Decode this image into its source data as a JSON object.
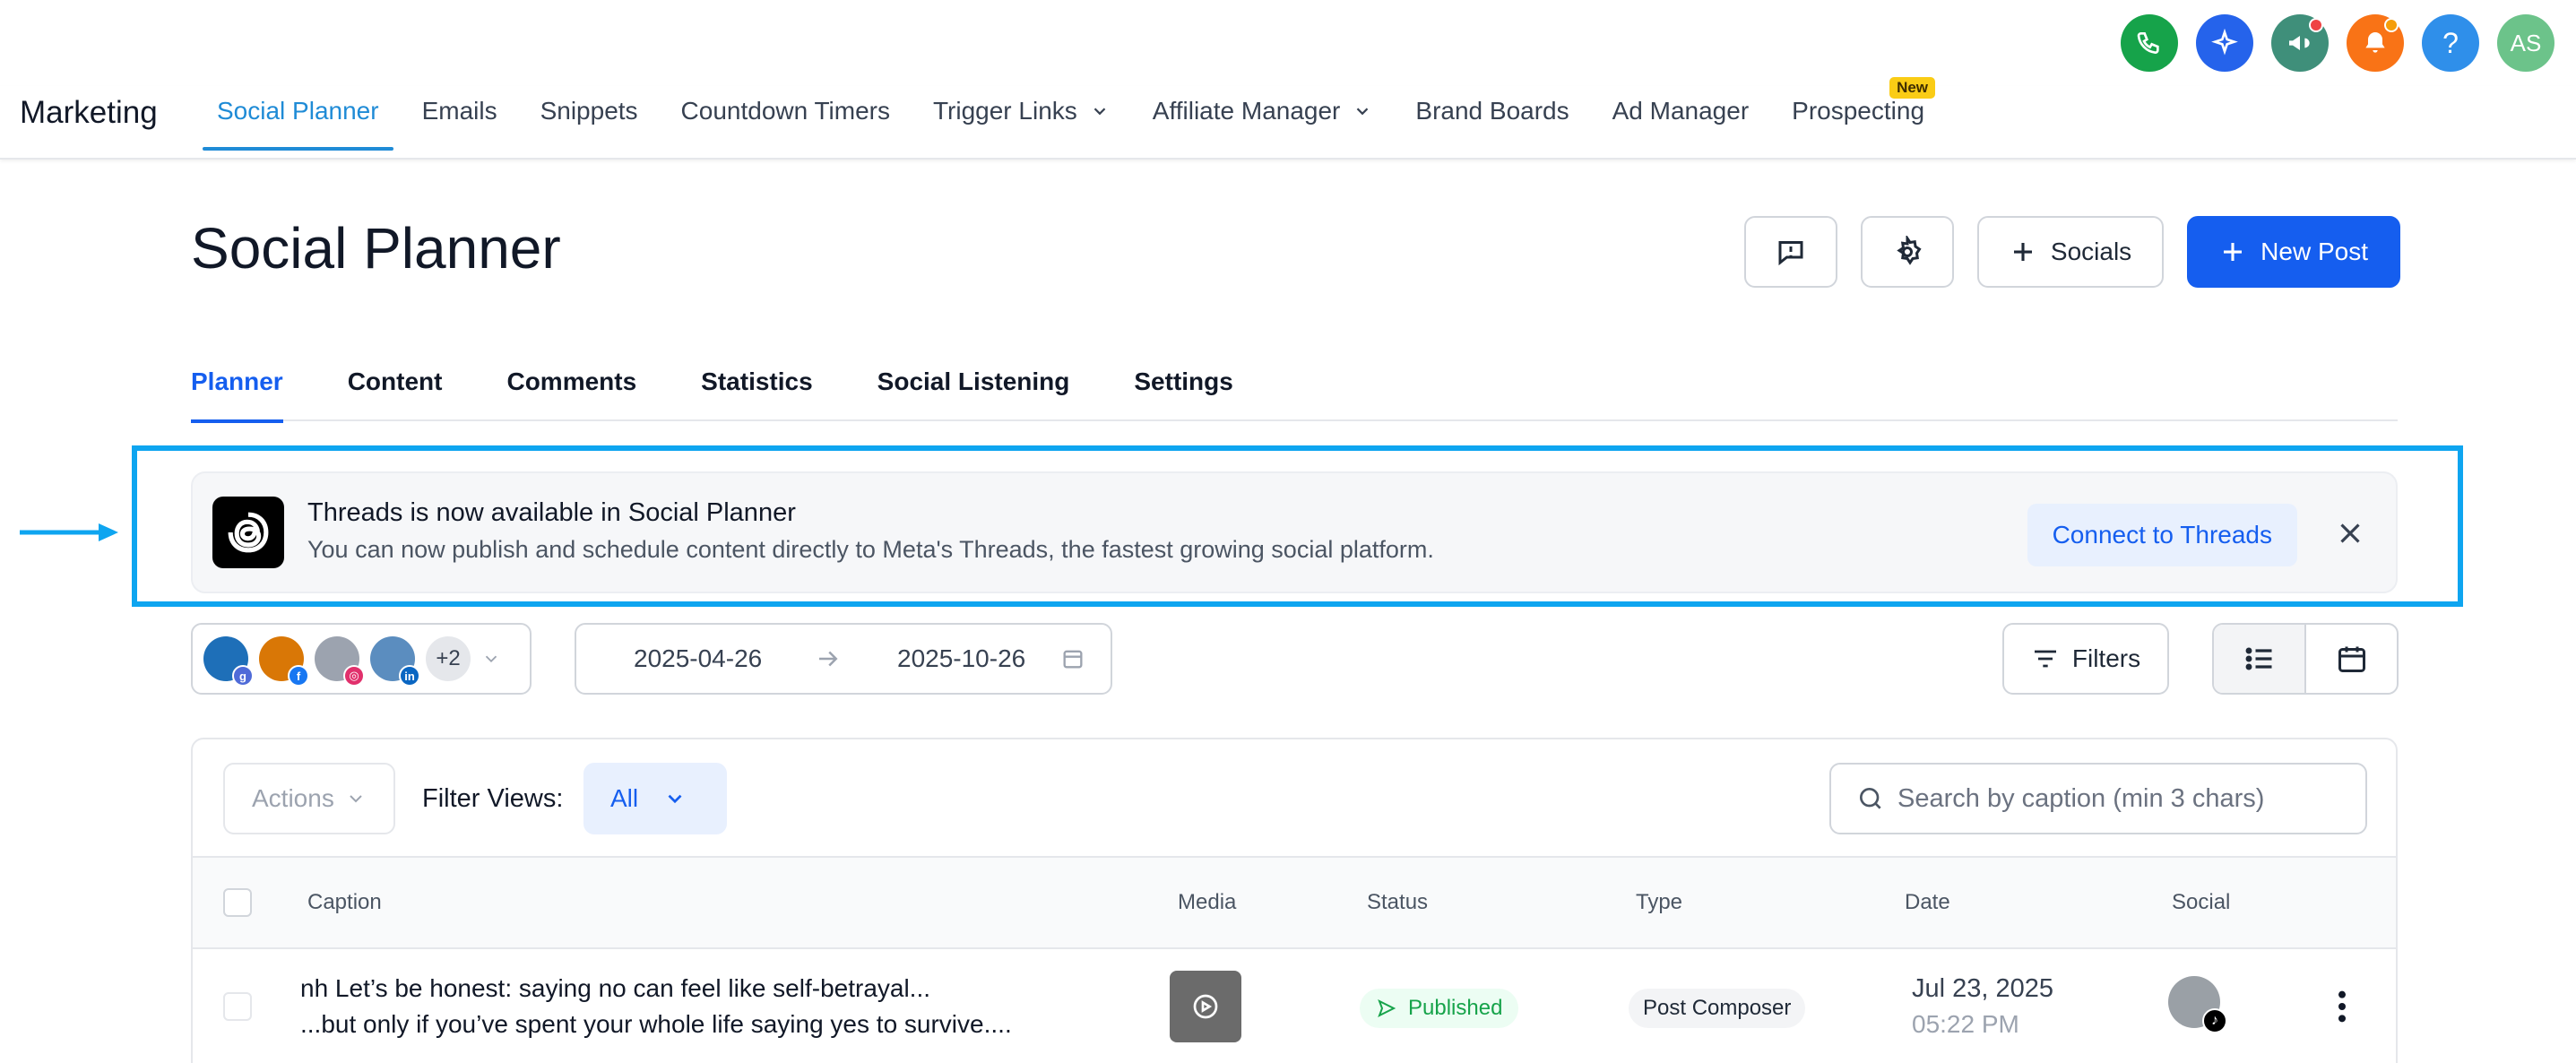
{
  "top_icons": {
    "avatar_initials": "AS",
    "help_symbol": "?",
    "colors": {
      "phone": "#16a34a",
      "ai": "#2563eb",
      "megaphone": "#3f8f7a",
      "bell": "#f97316",
      "help": "#2f8fea",
      "avatar": "#6cc38a",
      "notif_red": "#ef4444",
      "notif_orange": "#f59e0b"
    }
  },
  "header": {
    "brand": "Marketing",
    "nav": [
      {
        "label": "Social Planner",
        "active": true
      },
      {
        "label": "Emails"
      },
      {
        "label": "Snippets"
      },
      {
        "label": "Countdown Timers"
      },
      {
        "label": "Trigger Links",
        "dropdown": true
      },
      {
        "label": "Affiliate Manager",
        "dropdown": true
      },
      {
        "label": "Brand Boards"
      },
      {
        "label": "Ad Manager"
      },
      {
        "label": "Prospecting",
        "badge": "New"
      }
    ]
  },
  "page": {
    "title": "Social Planner",
    "socials_label": "Socials",
    "new_post_label": "New Post",
    "accent": "#155eef"
  },
  "subtabs": [
    "Planner",
    "Content",
    "Comments",
    "Statistics",
    "Social Listening",
    "Settings"
  ],
  "banner": {
    "title": "Threads is now available in Social Planner",
    "text": "You can now publish and schedule content directly to Meta's Threads, the fastest growing social platform.",
    "cta": "Connect to Threads",
    "highlight_color": "#0ea5f0"
  },
  "filters": {
    "more_accounts": "+2",
    "date_start": "2025-04-26",
    "date_end": "2025-10-26",
    "filters_label": "Filters"
  },
  "table": {
    "actions_label": "Actions",
    "filter_views_label": "Filter Views:",
    "filter_views_value": "All",
    "search_placeholder": "Search by caption (min 3 chars)",
    "headers": {
      "caption": "Caption",
      "media": "Media",
      "status": "Status",
      "type": "Type",
      "date": "Date",
      "social": "Social"
    },
    "rows": [
      {
        "caption_line1": "nh Let’s be honest: saying no can feel like self-betrayal...",
        "caption_line2": "...but only if you’ve spent your whole life saying yes to survive....",
        "status": "Published",
        "type": "Post Composer",
        "date": "Jul 23, 2025",
        "time": "05:22 PM"
      }
    ]
  }
}
